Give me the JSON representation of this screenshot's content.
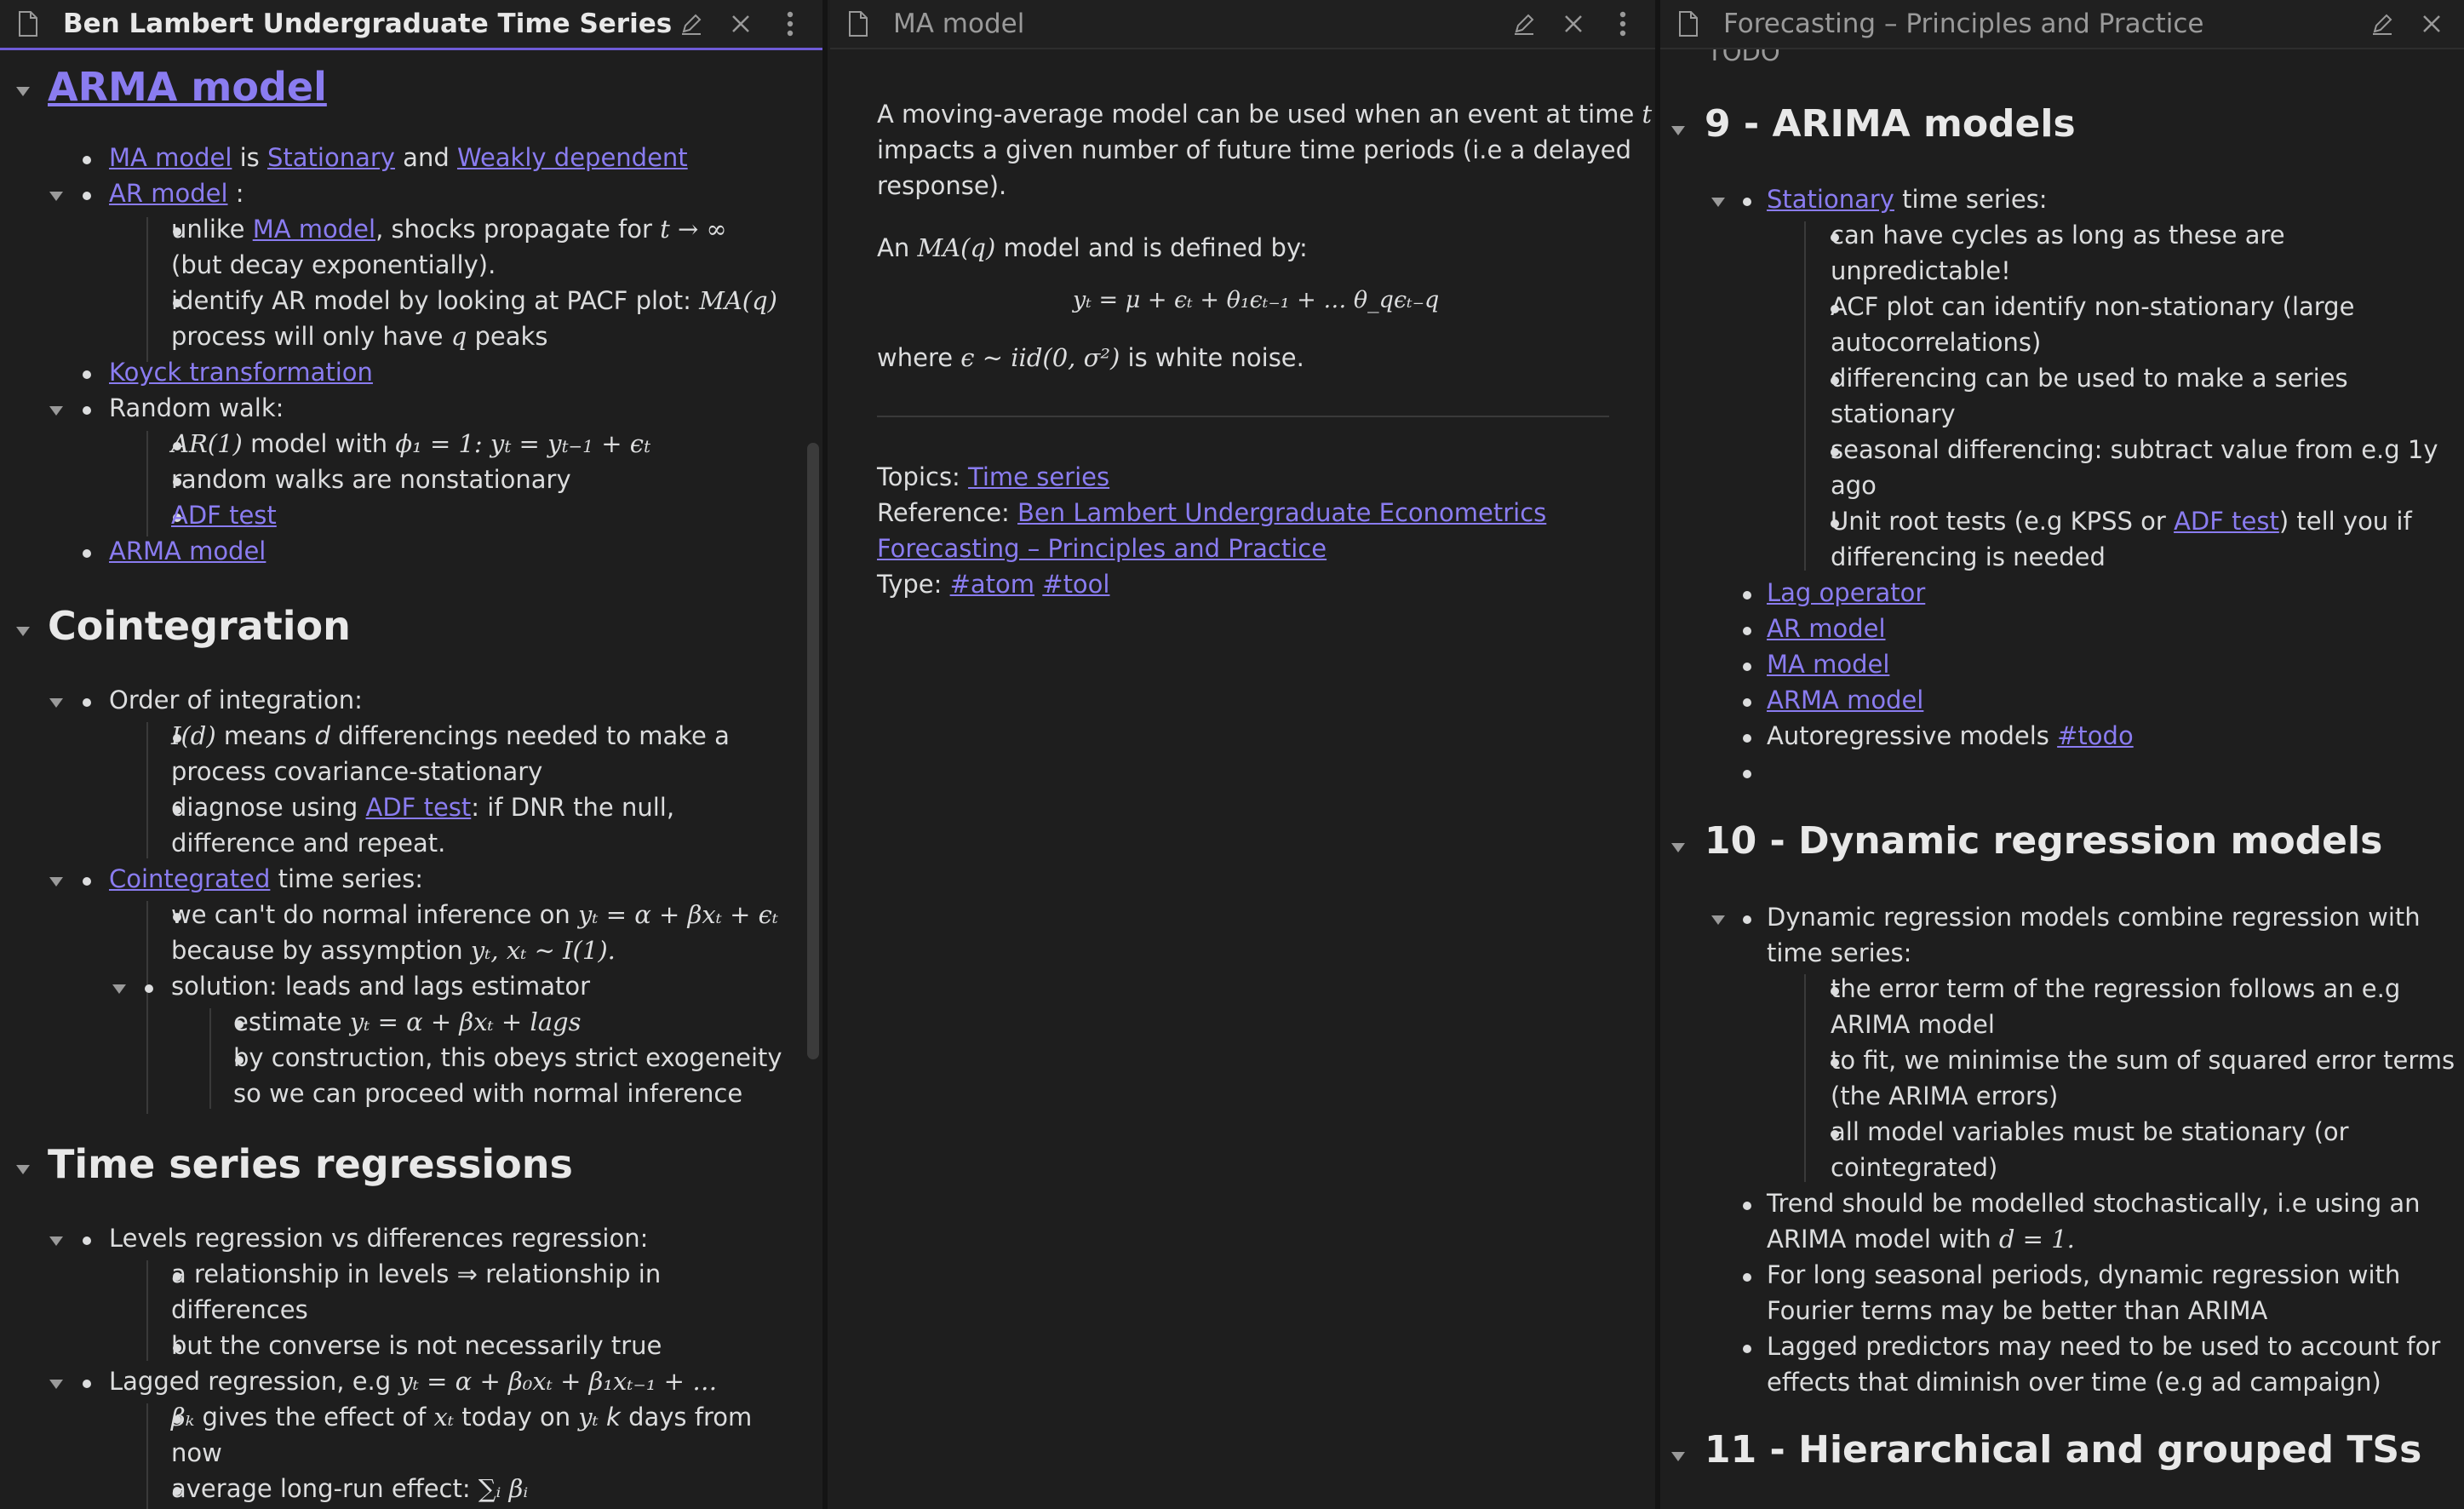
{
  "left": {
    "tab_title": "Ben Lambert Undergraduate Time Series",
    "h_arma": "ARMA model",
    "arma_l1": [
      "MA model",
      " is ",
      "Stationary",
      " and ",
      "Weakly dependent"
    ],
    "arma_l2_link": "AR model",
    "arma_l2_rest": " :",
    "arma_l3_a": "unlike ",
    "arma_l3_link": "MA model",
    "arma_l3_b": ", shocks propagate for ",
    "arma_l3_math": "t → ∞",
    "arma_l4": "(but decay exponentially).",
    "arma_l5_a": "identify AR model by looking at PACF plot: ",
    "arma_l5_math": "MA(q)",
    "arma_l6_a": "process will only have ",
    "arma_l6_q": "q",
    "arma_l6_b": " peaks",
    "arma_l7": "Koyck transformation",
    "arma_l8": "Random walk:",
    "arma_l9_math1": "AR(1)",
    "arma_l9_b": " model with ",
    "arma_l9_math2": "ϕ₁ = 1: y",
    "arma_l9_math3": "t",
    "arma_l9_math4": " = y",
    "arma_l9_math5": "t−1",
    "arma_l9_math6": " + ϵ",
    "arma_l9_math7": "t",
    "arma_l10": "random walks are nonstationary",
    "arma_l11": "ADF test",
    "arma_l12": "ARMA model",
    "h_coint": "Cointegration",
    "coint_l1": "Order of integration:",
    "coint_l2_math": "I(d)",
    "coint_l2_b": " means ",
    "coint_l2_d": "d",
    "coint_l2_c": " differencings needed to make a",
    "coint_l3": "process covariance-stationary",
    "coint_l4_a": "diagnose using ",
    "coint_l4_link": "ADF test",
    "coint_l4_b": ": if DNR the null,",
    "coint_l5": "difference and repeat.",
    "coint_l6_link": "Cointegrated",
    "coint_l6_b": " time series:",
    "coint_l7_a": "we can't do normal inference on ",
    "coint_l7_math": "yₜ = α + βxₜ + ϵₜ",
    "coint_l8_a": "because by assymption ",
    "coint_l8_math": "yₜ, xₜ ∼ I(1).",
    "coint_l9": "solution: leads and lags estimator",
    "coint_l10_a": "estimate ",
    "coint_l10_math": "yₜ = α + βxₜ + lags",
    "coint_l11": "by construction, this obeys strict exogeneity",
    "coint_l12": "so we can proceed with normal inference",
    "h_tsr": "Time series regressions",
    "tsr_l1": "Levels regression vs differences regression:",
    "tsr_l2": "a relationship in levels ⇒ relationship in",
    "tsr_l3": "differences",
    "tsr_l4": "but the converse is not necessarily true",
    "tsr_l5_a": "Lagged regression, e.g ",
    "tsr_l5_math": "yₜ = α + β₀xₜ + β₁xₜ₋₁ + …",
    "tsr_l6_math1": "βₖ",
    "tsr_l6_a": " gives the effect of ",
    "tsr_l6_math2": "xₜ",
    "tsr_l6_b": " today on ",
    "tsr_l6_math3": "yₜ",
    "tsr_l6_k": " k",
    "tsr_l6_c": " days from",
    "tsr_l7": "now",
    "tsr_l8_a": "average long-run effect: ",
    "tsr_l8_math": "∑ᵢ βᵢ"
  },
  "mid": {
    "tab_title": "MA model",
    "p1_l1_a": "A moving-average model can be used when an event at time ",
    "p1_l1_t": "t",
    "p1_l2": "impacts a given number of future time periods (i.e a delayed",
    "p1_l3": "response).",
    "p2_a": "An ",
    "p2_math": "MA(q)",
    "p2_b": " model and is defined by:",
    "formula": "yₜ = μ + ϵₜ + θ₁ϵₜ₋₁ + … θ_qϵₜ₋q",
    "p3_a": "where ",
    "p3_math": "ϵ ∼ iid(0, σ²)",
    "p3_b": " is white noise.",
    "topics_label": "Topics: ",
    "topics_link": "Time series",
    "ref_label": "Reference: ",
    "ref_link1": "Ben Lambert Undergraduate Econometrics",
    "ref_link2": "Forecasting – Principles and Practice",
    "type_label": "Type: ",
    "type_tag1": "#atom",
    "type_tag2": "#tool"
  },
  "right": {
    "tab_title": "Forecasting – Principles and Practice",
    "todo_top": "TODO",
    "h9": "9 - ARIMA models",
    "r9_l1_link": "Stationary",
    "r9_l1_b": " time series:",
    "r9_l2": "can have cycles as long as these are",
    "r9_l3": "unpredictable!",
    "r9_l4": "ACF plot can identify non-stationary (large",
    "r9_l5": "autocorrelations)",
    "r9_l6": "differencing can be used to make a series",
    "r9_l7": "stationary",
    "r9_l8": "seasonal differencing: subtract value from e.g 1y",
    "r9_l9": "ago",
    "r9_l10_a": "Unit root tests (e.g KPSS or ",
    "r9_l10_link": "ADF test",
    "r9_l10_b": ") tell you if",
    "r9_l11": "differencing is needed",
    "r9_l12": "Lag operator",
    "r9_l13": "AR model",
    "r9_l14": "MA model",
    "r9_l15": "ARMA model",
    "r9_l16_a": "Autoregressive models ",
    "r9_l16_tag": "#todo",
    "h10": "10 - Dynamic regression models",
    "r10_l1": "Dynamic regression models combine regression with",
    "r10_l2": "time series:",
    "r10_l3": "the error term of the regression follows an e.g",
    "r10_l4": "ARIMA model",
    "r10_l5": "to fit, we minimise the sum of squared error terms",
    "r10_l6": "(the ARIMA errors)",
    "r10_l7": "all model variables must be stationary (or",
    "r10_l8": "cointegrated)",
    "r10_l9": "Trend should be modelled stochastically, i.e using an",
    "r10_l10_a": "ARIMA model with ",
    "r10_l10_math": "d = 1.",
    "r10_l11": "For long seasonal periods, dynamic regression with",
    "r10_l12": "Fourier terms may be better than ARIMA",
    "r10_l13": "Lagged predictors may need to be used to account for",
    "r10_l14": "effects that diminish over time (e.g ad campaign)",
    "h11": "11 - Hierarchical and grouped TSs"
  }
}
